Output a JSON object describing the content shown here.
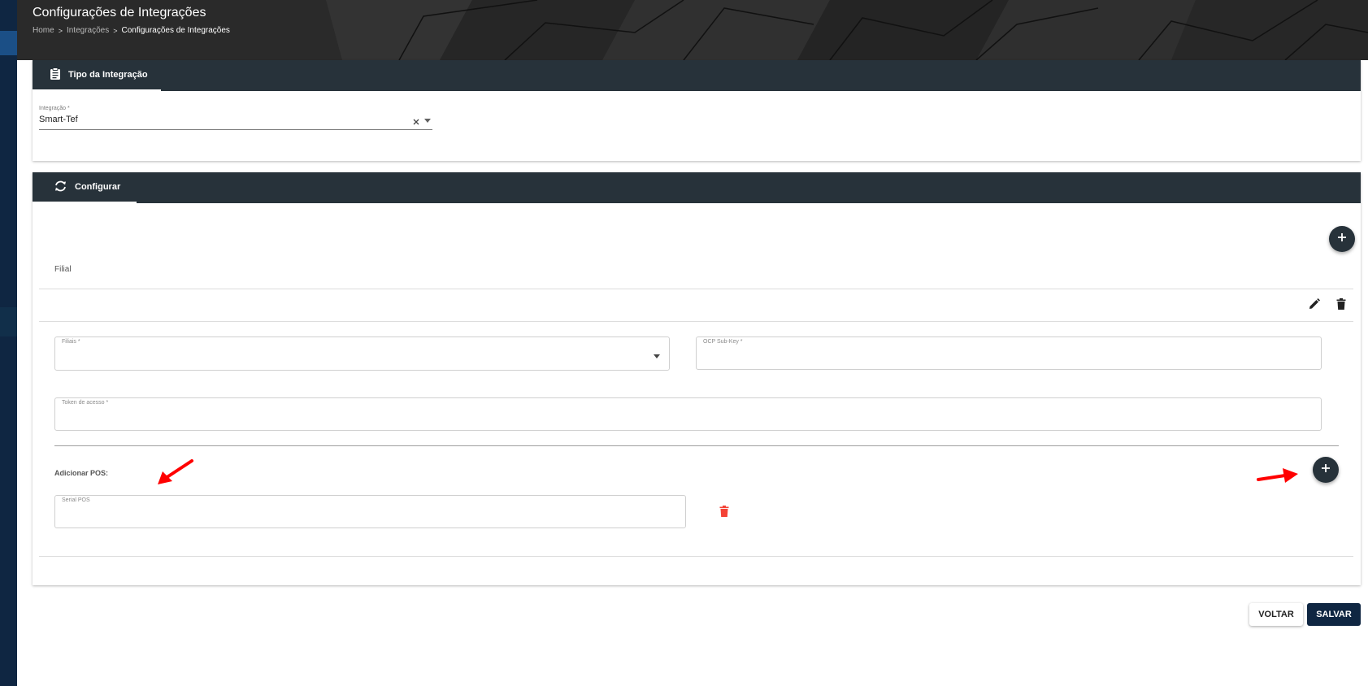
{
  "header": {
    "title": "Configurações de Integrações",
    "breadcrumb": [
      "Home",
      "Integrações",
      "Configurações de Integrações"
    ]
  },
  "type_card": {
    "tab_label": "Tipo da Integração",
    "integration_field": {
      "label": "Integração *",
      "value": "Smart-Tef"
    }
  },
  "config_card": {
    "tab_label": "Configurar",
    "column_header": "Filial",
    "fields": {
      "filiais_label": "Filiais *",
      "ocp_label": "OCP Sub-Key *",
      "token_label": "Token de acesso *"
    },
    "pos": {
      "section_label": "Adicionar POS:",
      "serial_label": "Serial POS"
    }
  },
  "actions": {
    "back_label": "VOLTAR",
    "save_label": "SALVAR"
  },
  "icons": {
    "type_tab": "clipboard-icon",
    "config_tab": "sync-icon",
    "add": "plus-icon",
    "edit": "pencil-icon",
    "delete": "trash-icon",
    "clear": "close-icon"
  },
  "colors": {
    "sidebar": "#0f2642",
    "tabbar": "#27323a",
    "save_button": "#0f2642",
    "delete_pos": "#f44336",
    "annotation_arrow": "#ff0000"
  }
}
